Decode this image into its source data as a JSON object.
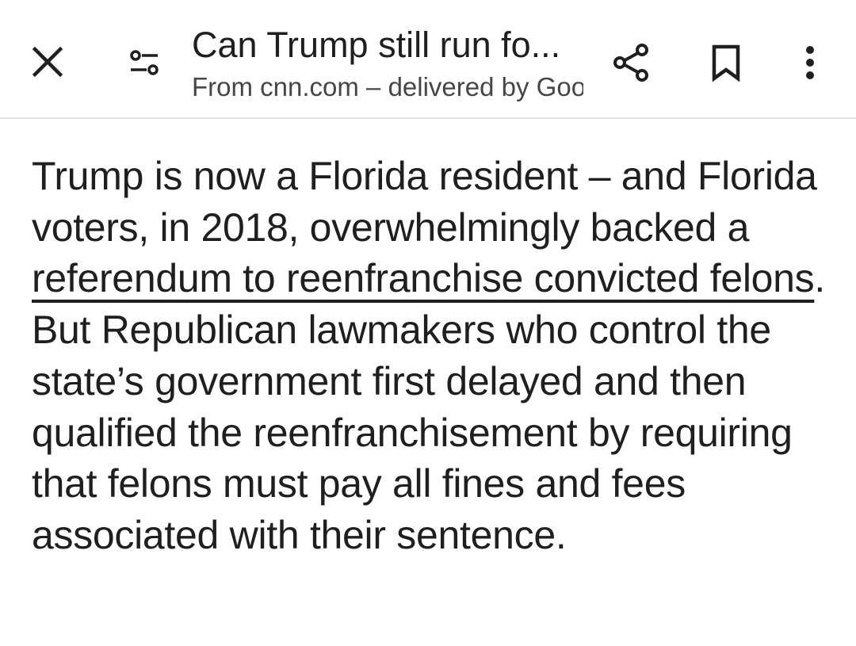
{
  "header": {
    "title": "Can Trump still run fo...",
    "subtitle": "From cnn.com – delivered by Google",
    "icons": {
      "close": "close-icon",
      "customize": "tune-icon",
      "share": "share-icon",
      "bookmark": "bookmark-icon",
      "more": "more-vert-icon"
    }
  },
  "article": {
    "text_before_link": "Trump is now a Florida resident – and Florida voters, in 2018, overwhelmingly backed a ",
    "link_text": "referendum to reenfranchise convicted felons",
    "text_after_link": ". But Republican lawmakers who control the state’s government first delayed and then qualified the reenfranchisement by requiring that felons must pay all fines and fees associated with their sentence."
  },
  "colors": {
    "text": "#1f1f1f",
    "subtitle": "#444746",
    "divider": "#e3e3e3",
    "background": "#ffffff"
  }
}
